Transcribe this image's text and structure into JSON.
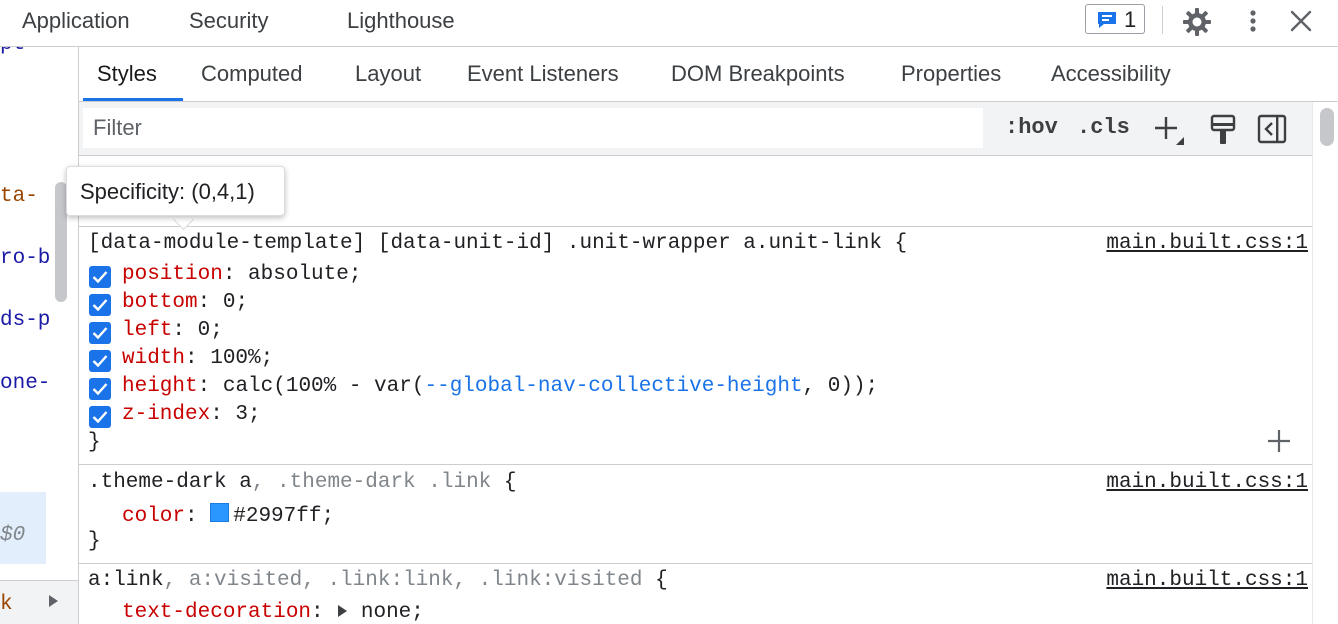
{
  "top_tabs": [
    {
      "label": "Application"
    },
    {
      "label": "Security"
    },
    {
      "label": "Lighthouse"
    }
  ],
  "toolbar_top": {
    "issues_count": "1"
  },
  "dom_fragments": [
    "pt",
    "ta-",
    "ro-b",
    "ds-p",
    "one-",
    "$0",
    "k"
  ],
  "sub_tabs": [
    {
      "label": "Styles"
    },
    {
      "label": "Computed"
    },
    {
      "label": "Layout"
    },
    {
      "label": "Event Listeners"
    },
    {
      "label": "DOM Breakpoints"
    },
    {
      "label": "Properties"
    },
    {
      "label": "Accessibility"
    }
  ],
  "filter": {
    "placeholder": "Filter",
    "hov": ":hov",
    "cls": ".cls"
  },
  "tooltip": {
    "text": "Specificity: (0,4,1)"
  },
  "rules": {
    "rule1": {
      "selector": "[data-module-template] [data-unit-id] .unit-wrapper a.unit-link {",
      "source": "main.built.css:1",
      "props": [
        {
          "name": "position",
          "value": " absolute;"
        },
        {
          "name": "bottom",
          "value": " 0;"
        },
        {
          "name": "left",
          "value": " 0;"
        },
        {
          "name": "width",
          "value": " 100%;"
        },
        {
          "name": "height",
          "value_pre": " calc(100% - var(",
          "value_var": "--global-nav-collective-height",
          "value_post": ", 0));"
        },
        {
          "name": "z-index",
          "value": " 3;"
        }
      ],
      "close": "}"
    },
    "rule2": {
      "sel_a": ".theme-dark a",
      "sel_b": ", .theme-dark .link",
      "brace": " {",
      "source": "main.built.css:1",
      "prop_name": "color",
      "prop_value": "#2997ff;",
      "swatch_color": "#2997ff",
      "close": "}"
    },
    "rule3": {
      "sel_a": "a:link",
      "sel_b": ", a:visited, .link:link, .link:visited",
      "brace": " {",
      "source": "main.built.css:1",
      "prop_name": "text-decoration",
      "prop_value": "none;"
    }
  },
  "colors": {
    "accent": "#1a73e8",
    "prop_name": "#c80000",
    "selection_bg": "#e3eefc"
  }
}
